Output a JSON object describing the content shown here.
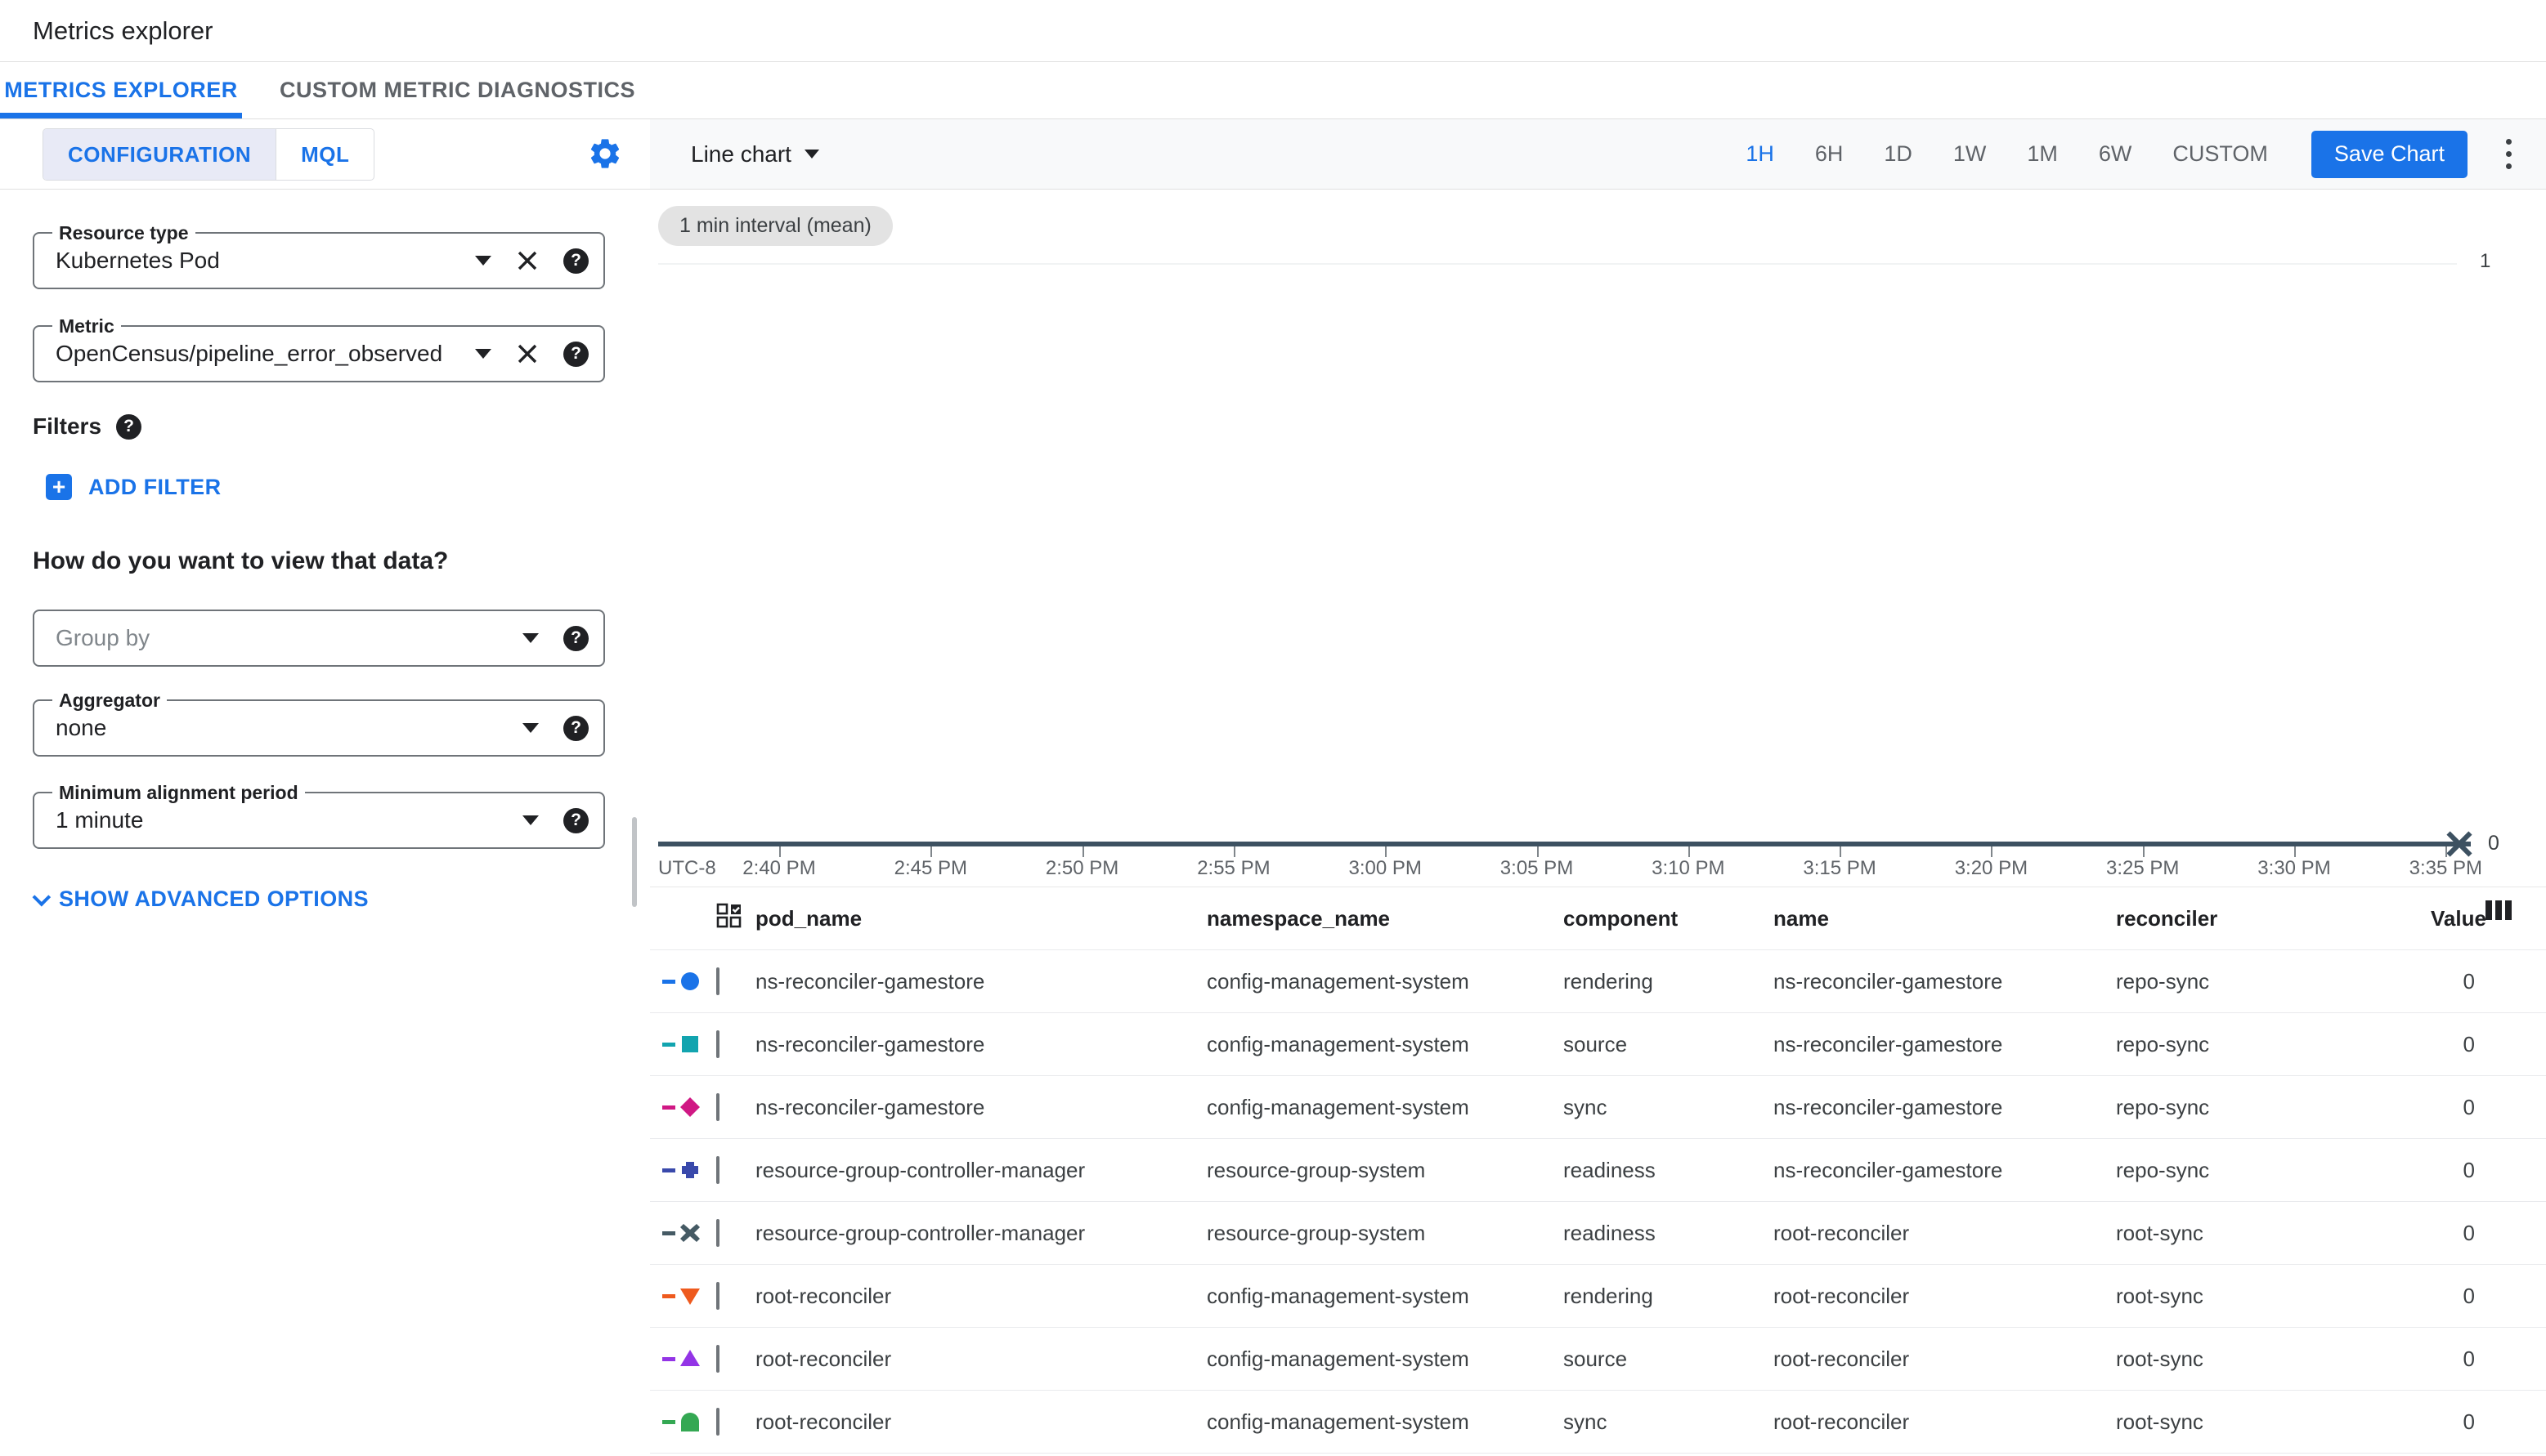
{
  "header": {
    "title": "Metrics explorer",
    "tabs": [
      {
        "label": "METRICS EXPLORER",
        "active": true
      },
      {
        "label": "CUSTOM METRIC DIAGNOSTICS",
        "active": false
      }
    ]
  },
  "config_panel": {
    "mode_tabs": [
      {
        "label": "CONFIGURATION",
        "selected": true
      },
      {
        "label": "MQL",
        "selected": false
      }
    ],
    "settings_icon": "gear-icon",
    "resource_type": {
      "label": "Resource type",
      "value": "Kubernetes Pod"
    },
    "metric": {
      "label": "Metric",
      "value": "OpenCensus/pipeline_error_observed"
    },
    "filters": {
      "heading": "Filters",
      "add_filter_label": "ADD FILTER"
    },
    "view_question": "How do you want to view that data?",
    "group_by": {
      "placeholder": "Group by"
    },
    "aggregator": {
      "label": "Aggregator",
      "value": "none"
    },
    "min_alignment": {
      "label": "Minimum alignment period",
      "value": "1 minute"
    },
    "advanced_toggle_label": "SHOW ADVANCED OPTIONS"
  },
  "toolbar": {
    "chart_type_label": "Line chart",
    "time_ranges": [
      {
        "label": "1H",
        "active": true
      },
      {
        "label": "6H",
        "active": false
      },
      {
        "label": "1D",
        "active": false
      },
      {
        "label": "1W",
        "active": false
      },
      {
        "label": "1M",
        "active": false
      },
      {
        "label": "6W",
        "active": false
      },
      {
        "label": "CUSTOM",
        "active": false
      }
    ],
    "save_label": "Save Chart",
    "accent_color": "#1a73e8"
  },
  "chart": {
    "interval_chip": "1 min interval (mean)",
    "timezone_label": "UTC-8",
    "x_labels": [
      "2:40 PM",
      "2:45 PM",
      "2:50 PM",
      "2:55 PM",
      "3:00 PM",
      "3:05 PM",
      "3:10 PM",
      "3:15 PM",
      "3:20 PM",
      "3:25 PM",
      "3:30 PM",
      "3:35 PM"
    ],
    "y_upper_label": "1",
    "y_zero_label": "0",
    "axis_color": "#3d5161"
  },
  "chart_data": {
    "type": "line",
    "title": "",
    "xlabel": "time (UTC-8)",
    "ylabel": "",
    "x": [
      "2:40 PM",
      "2:45 PM",
      "2:50 PM",
      "2:55 PM",
      "3:00 PM",
      "3:05 PM",
      "3:10 PM",
      "3:15 PM",
      "3:20 PM",
      "3:25 PM",
      "3:30 PM",
      "3:35 PM"
    ],
    "ylim": [
      0,
      1
    ],
    "y_ticks": [
      0,
      1
    ],
    "grid": "horizontal-faint",
    "legend_position": "table-below",
    "series": [
      {
        "name": "ns-reconciler-gamestore rendering repo-sync",
        "marker": "circle",
        "color": "#1a73e8",
        "values": [
          0,
          0,
          0,
          0,
          0,
          0,
          0,
          0,
          0,
          0,
          0,
          0
        ]
      },
      {
        "name": "ns-reconciler-gamestore source repo-sync",
        "marker": "square",
        "color": "#12a4af",
        "values": [
          0,
          0,
          0,
          0,
          0,
          0,
          0,
          0,
          0,
          0,
          0,
          0
        ]
      },
      {
        "name": "ns-reconciler-gamestore sync repo-sync",
        "marker": "diamond",
        "color": "#d01884",
        "values": [
          0,
          0,
          0,
          0,
          0,
          0,
          0,
          0,
          0,
          0,
          0,
          0
        ]
      },
      {
        "name": "resource-group-controller-manager readiness repo-sync",
        "marker": "plus",
        "color": "#3949ab",
        "values": [
          0,
          0,
          0,
          0,
          0,
          0,
          0,
          0,
          0,
          0,
          0,
          0
        ]
      },
      {
        "name": "resource-group-controller-manager readiness root-sync",
        "marker": "x",
        "color": "#455a64",
        "values": [
          0,
          0,
          0,
          0,
          0,
          0,
          0,
          0,
          0,
          0,
          0,
          0
        ]
      },
      {
        "name": "root-reconciler rendering root-sync",
        "marker": "triangle-down",
        "color": "#ee5a1e",
        "values": [
          0,
          0,
          0,
          0,
          0,
          0,
          0,
          0,
          0,
          0,
          0,
          0
        ]
      },
      {
        "name": "root-reconciler source root-sync",
        "marker": "triangle-up",
        "color": "#9334e6",
        "values": [
          0,
          0,
          0,
          0,
          0,
          0,
          0,
          0,
          0,
          0,
          0,
          0
        ]
      },
      {
        "name": "root-reconciler sync root-sync",
        "marker": "dome",
        "color": "#34a853",
        "values": [
          0,
          0,
          0,
          0,
          0,
          0,
          0,
          0,
          0,
          0,
          0,
          0
        ]
      }
    ]
  },
  "table": {
    "columns": [
      "pod_name",
      "namespace_name",
      "component",
      "name",
      "reconciler",
      "Value"
    ],
    "rows": [
      {
        "marker": {
          "shape": "circle",
          "color": "#1a73e8"
        },
        "pod_name": "ns-reconciler-gamestore",
        "namespace_name": "config-management-system",
        "component": "rendering",
        "name": "ns-reconciler-gamestore",
        "reconciler": "repo-sync",
        "value": "0"
      },
      {
        "marker": {
          "shape": "square",
          "color": "#12a4af"
        },
        "pod_name": "ns-reconciler-gamestore",
        "namespace_name": "config-management-system",
        "component": "source",
        "name": "ns-reconciler-gamestore",
        "reconciler": "repo-sync",
        "value": "0"
      },
      {
        "marker": {
          "shape": "diamond",
          "color": "#d01884"
        },
        "pod_name": "ns-reconciler-gamestore",
        "namespace_name": "config-management-system",
        "component": "sync",
        "name": "ns-reconciler-gamestore",
        "reconciler": "repo-sync",
        "value": "0"
      },
      {
        "marker": {
          "shape": "plus",
          "color": "#3949ab"
        },
        "pod_name": "resource-group-controller-manager",
        "namespace_name": "resource-group-system",
        "component": "readiness",
        "name": "ns-reconciler-gamestore",
        "reconciler": "repo-sync",
        "value": "0"
      },
      {
        "marker": {
          "shape": "x",
          "color": "#455a64"
        },
        "pod_name": "resource-group-controller-manager",
        "namespace_name": "resource-group-system",
        "component": "readiness",
        "name": "root-reconciler",
        "reconciler": "root-sync",
        "value": "0"
      },
      {
        "marker": {
          "shape": "triangle-down",
          "color": "#ee5a1e"
        },
        "pod_name": "root-reconciler",
        "namespace_name": "config-management-system",
        "component": "rendering",
        "name": "root-reconciler",
        "reconciler": "root-sync",
        "value": "0"
      },
      {
        "marker": {
          "shape": "triangle-up",
          "color": "#9334e6"
        },
        "pod_name": "root-reconciler",
        "namespace_name": "config-management-system",
        "component": "source",
        "name": "root-reconciler",
        "reconciler": "root-sync",
        "value": "0"
      },
      {
        "marker": {
          "shape": "dome",
          "color": "#34a853"
        },
        "pod_name": "root-reconciler",
        "namespace_name": "config-management-system",
        "component": "sync",
        "name": "root-reconciler",
        "reconciler": "root-sync",
        "value": "0"
      }
    ]
  }
}
